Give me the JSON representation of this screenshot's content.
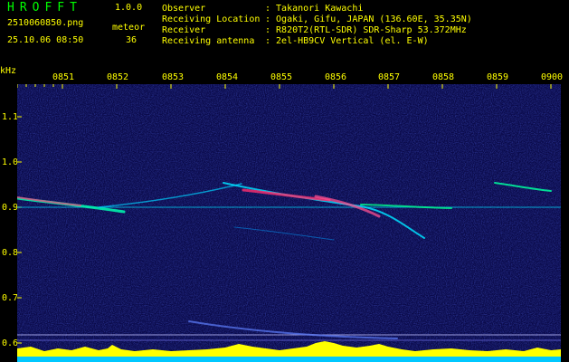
{
  "header": {
    "app_name": "HROFFT",
    "app_version": "1.0.0",
    "filename": "2510060850.png",
    "timestamp": "25.10.06 08:50",
    "meteor_label": "meteor",
    "meteor_count": "36"
  },
  "info": [
    {
      "key": "Observer",
      "value": ": Takanori Kawachi"
    },
    {
      "key": "Receiving Location",
      "value": ": Ogaki, Gifu, JAPAN (136.60E, 35.35N)"
    },
    {
      "key": "Receiver",
      "value": ": R820T2(RTL-SDR) SDR-Sharp 53.372MHz"
    },
    {
      "key": "Receiving antenna",
      "value": ": 2el-HB9CV Vertical (el. E-W)"
    }
  ],
  "plot": {
    "y_unit": "kHz",
    "time_labels": [
      "0851",
      "0852",
      "0853",
      "0854",
      "0855",
      "0856",
      "0857",
      "0858",
      "0859",
      "0900"
    ],
    "freq_labels": [
      "1.1",
      "1.0",
      "0.9",
      "0.8",
      "0.7",
      "0.6"
    ],
    "colors": {
      "background": "#0a0a4a",
      "label": "#ffff00",
      "trace": "#00e0ff",
      "hot": "#ff3060",
      "spectrum": "#ffff00"
    }
  }
}
